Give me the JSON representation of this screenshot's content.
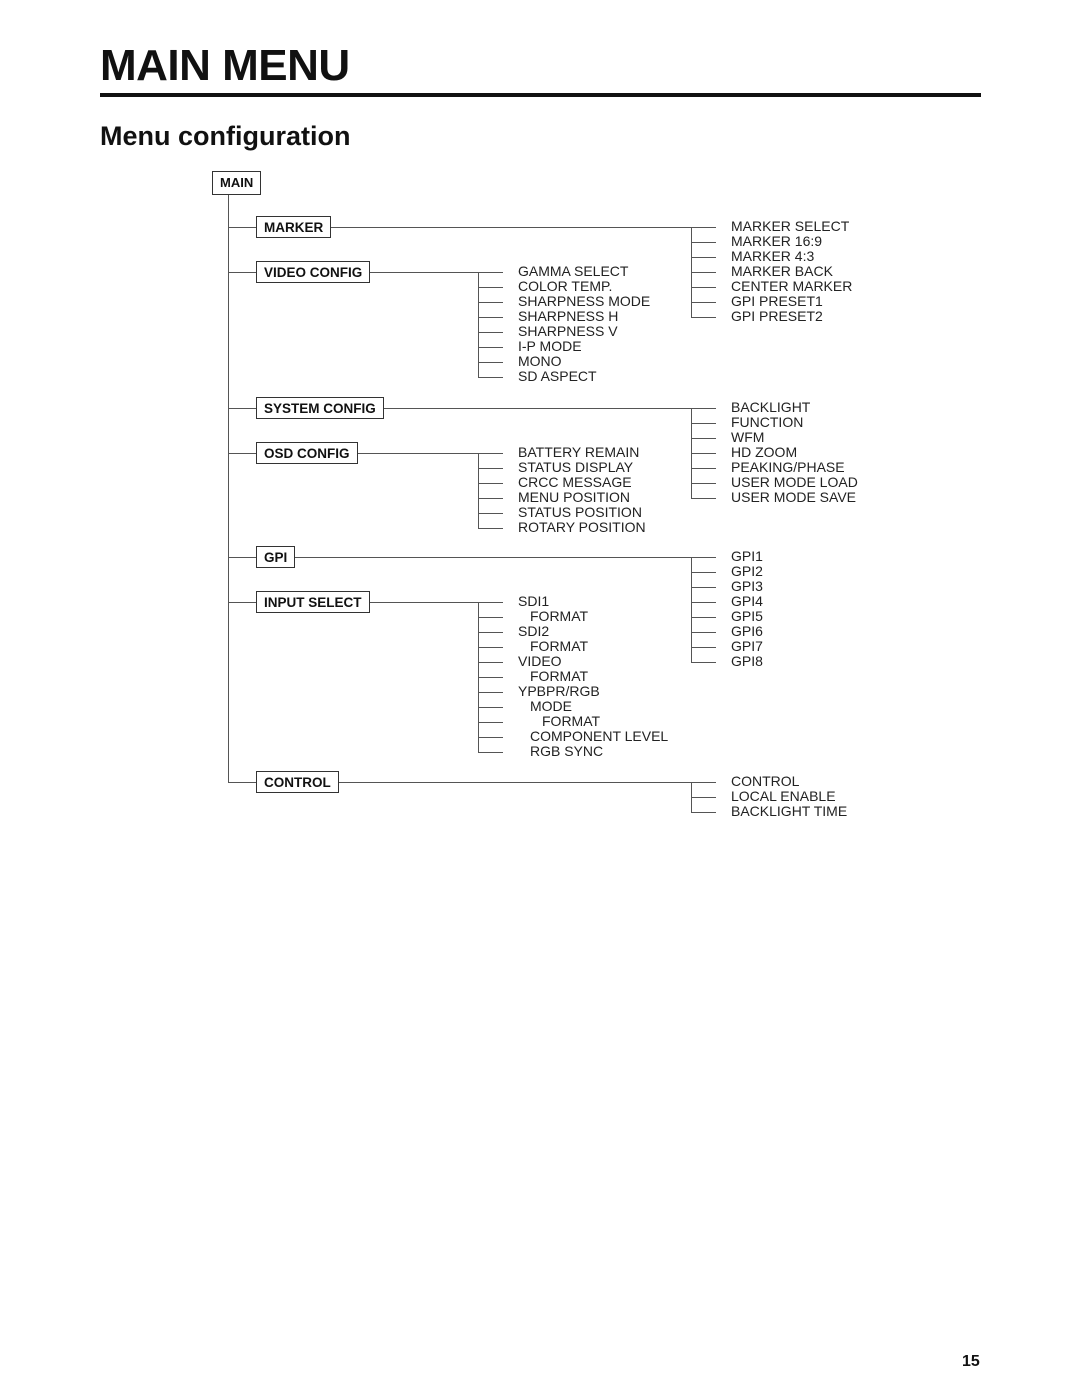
{
  "page": {
    "title": "MAIN MENU",
    "subtitle": "Menu configuration",
    "page_number": "15"
  },
  "tree": {
    "root": "MAIN",
    "menus": [
      {
        "label": "MARKER",
        "side": "right",
        "items": [
          "MARKER SELECT",
          "MARKER 16:9",
          "MARKER 4:3",
          "MARKER BACK",
          "CENTER MARKER",
          "GPI PRESET1",
          "GPI PRESET2"
        ]
      },
      {
        "label": "VIDEO CONFIG",
        "side": "middle",
        "items": [
          "GAMMA SELECT",
          "COLOR TEMP.",
          "SHARPNESS MODE",
          "SHARPNESS H",
          "SHARPNESS V",
          "I-P MODE",
          "MONO",
          "SD ASPECT"
        ]
      },
      {
        "label": "SYSTEM CONFIG",
        "side": "right",
        "items": [
          "BACKLIGHT",
          "FUNCTION",
          "WFM",
          "HD ZOOM",
          "PEAKING/PHASE",
          "USER MODE LOAD",
          "USER MODE SAVE"
        ]
      },
      {
        "label": "OSD CONFIG",
        "side": "middle",
        "items": [
          "BATTERY REMAIN",
          "STATUS DISPLAY",
          "CRCC MESSAGE",
          "MENU POSITION",
          "STATUS POSITION",
          "ROTARY POSITION"
        ]
      },
      {
        "label": "GPI",
        "side": "right",
        "items": [
          "GPI1",
          "GPI2",
          "GPI3",
          "GPI4",
          "GPI5",
          "GPI6",
          "GPI7",
          "GPI8"
        ]
      },
      {
        "label": "INPUT SELECT",
        "side": "middle",
        "items": [
          {
            "text": "SDI1",
            "indent": 0
          },
          {
            "text": "FORMAT",
            "indent": 1
          },
          {
            "text": "SDI2",
            "indent": 0
          },
          {
            "text": "FORMAT",
            "indent": 1
          },
          {
            "text": "VIDEO",
            "indent": 0
          },
          {
            "text": "FORMAT",
            "indent": 1
          },
          {
            "text": "YPBPR/RGB",
            "indent": 0
          },
          {
            "text": "MODE",
            "indent": 1
          },
          {
            "text": "FORMAT",
            "indent": 2
          },
          {
            "text": "COMPONENT LEVEL",
            "indent": 1
          },
          {
            "text": "RGB SYNC",
            "indent": 1
          }
        ]
      },
      {
        "label": "CONTROL",
        "side": "right",
        "items": [
          "CONTROL",
          "LOCAL ENABLE",
          "BACKLIGHT TIME"
        ]
      }
    ]
  }
}
